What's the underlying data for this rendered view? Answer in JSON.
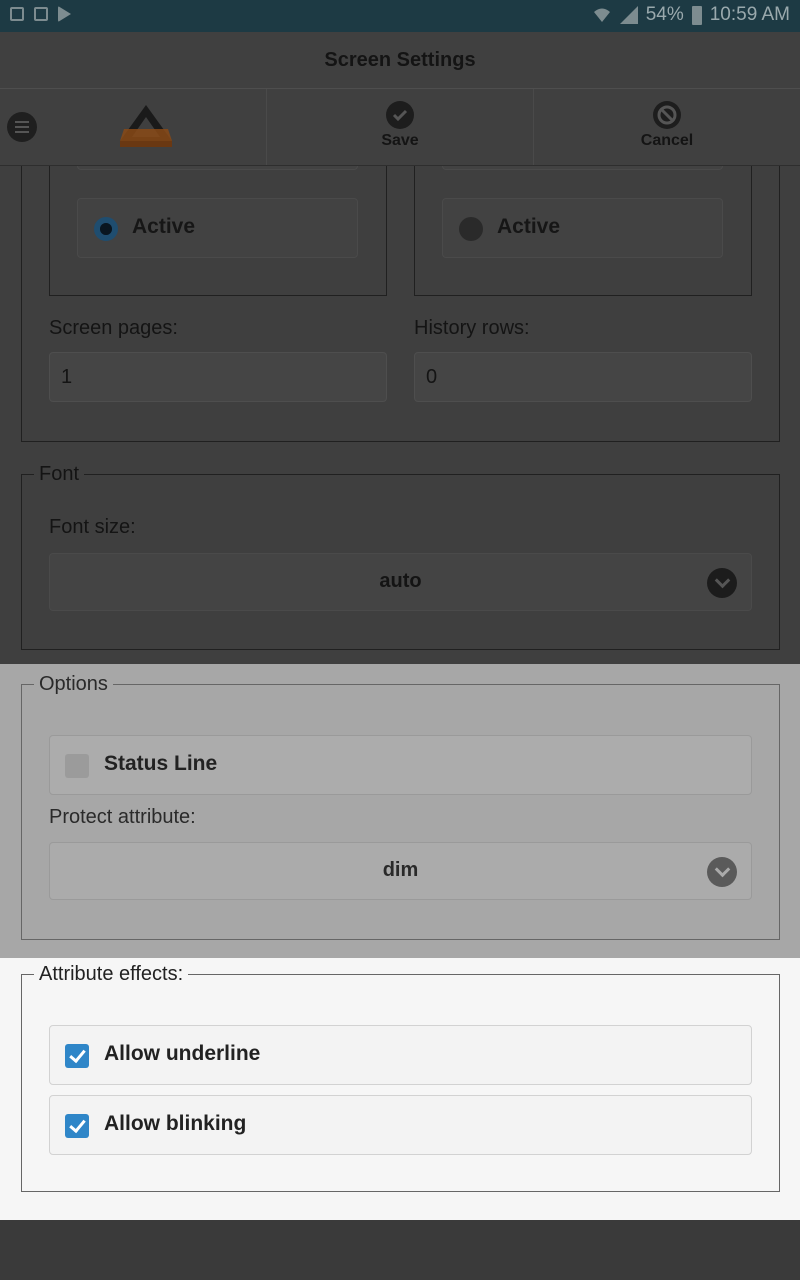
{
  "status_bar": {
    "battery": "54%",
    "time": "10:59 AM"
  },
  "header": {
    "title": "Screen Settings"
  },
  "toolbar": {
    "save_label": "Save",
    "cancel_label": "Cancel"
  },
  "screen": {
    "left_radio_label": "Active",
    "right_radio_label": "Active",
    "screen_pages_label": "Screen pages:",
    "screen_pages_value": "1",
    "history_rows_label": "History rows:",
    "history_rows_value": "0"
  },
  "font": {
    "legend": "Font",
    "size_label": "Font size:",
    "size_value": "auto"
  },
  "options": {
    "legend": "Options",
    "status_line_label": "Status Line",
    "status_line_checked": false,
    "protect_label": "Protect attribute:",
    "protect_value": "dim"
  },
  "attribute_effects": {
    "legend": "Attribute effects:",
    "underline_label": "Allow underline",
    "underline_checked": true,
    "blinking_label": "Allow blinking",
    "blinking_checked": true
  },
  "colors": {
    "accent": "#2f86c8",
    "status_bar": "#1d3a44",
    "logo_orange": "#e8731c"
  }
}
